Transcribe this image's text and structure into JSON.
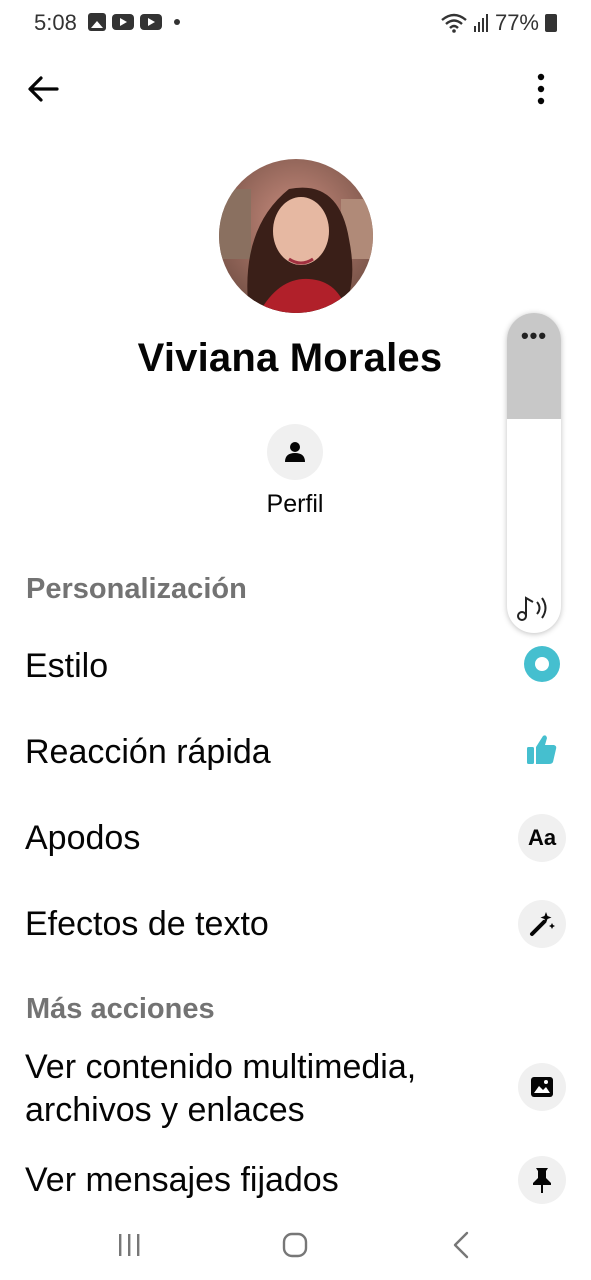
{
  "status_bar": {
    "time": "5:08",
    "battery": "77%"
  },
  "top_bar": {
    "back_icon": "arrow-left-icon",
    "more_icon": "vertical-dots-icon"
  },
  "profile": {
    "name": "Viviana Morales",
    "profile_button_label": "Perfil",
    "profile_button_icon": "person-icon"
  },
  "sections": {
    "personalization_title": "Personalización",
    "more_actions_title": "Más acciones"
  },
  "personalization_items": [
    {
      "label": "Estilo",
      "icon": "theme-circle-icon"
    },
    {
      "label": "Reacción rápida",
      "icon": "thumbs-up-icon"
    },
    {
      "label": "Apodos",
      "icon": "text-aa-icon",
      "icon_text": "Aa"
    },
    {
      "label": "Efectos de texto",
      "icon": "magic-wand-icon"
    }
  ],
  "more_actions_items": [
    {
      "label_line1": "Ver contenido multimedia,",
      "label_line2": "archivos y enlaces",
      "icon": "image-icon"
    },
    {
      "label": "Ver mensajes fijados",
      "icon": "pin-icon"
    }
  ],
  "floating_panel": {
    "dots_icon": "horizontal-dots-icon",
    "music_icon": "music-sound-icon"
  },
  "nav_bar": {
    "recent_icon": "recent-apps-icon",
    "home_icon": "home-icon",
    "back_icon": "nav-back-icon"
  },
  "colors": {
    "accent": "#45bfcf",
    "section_title": "#737373",
    "icon_bg": "#f0f0f0"
  }
}
